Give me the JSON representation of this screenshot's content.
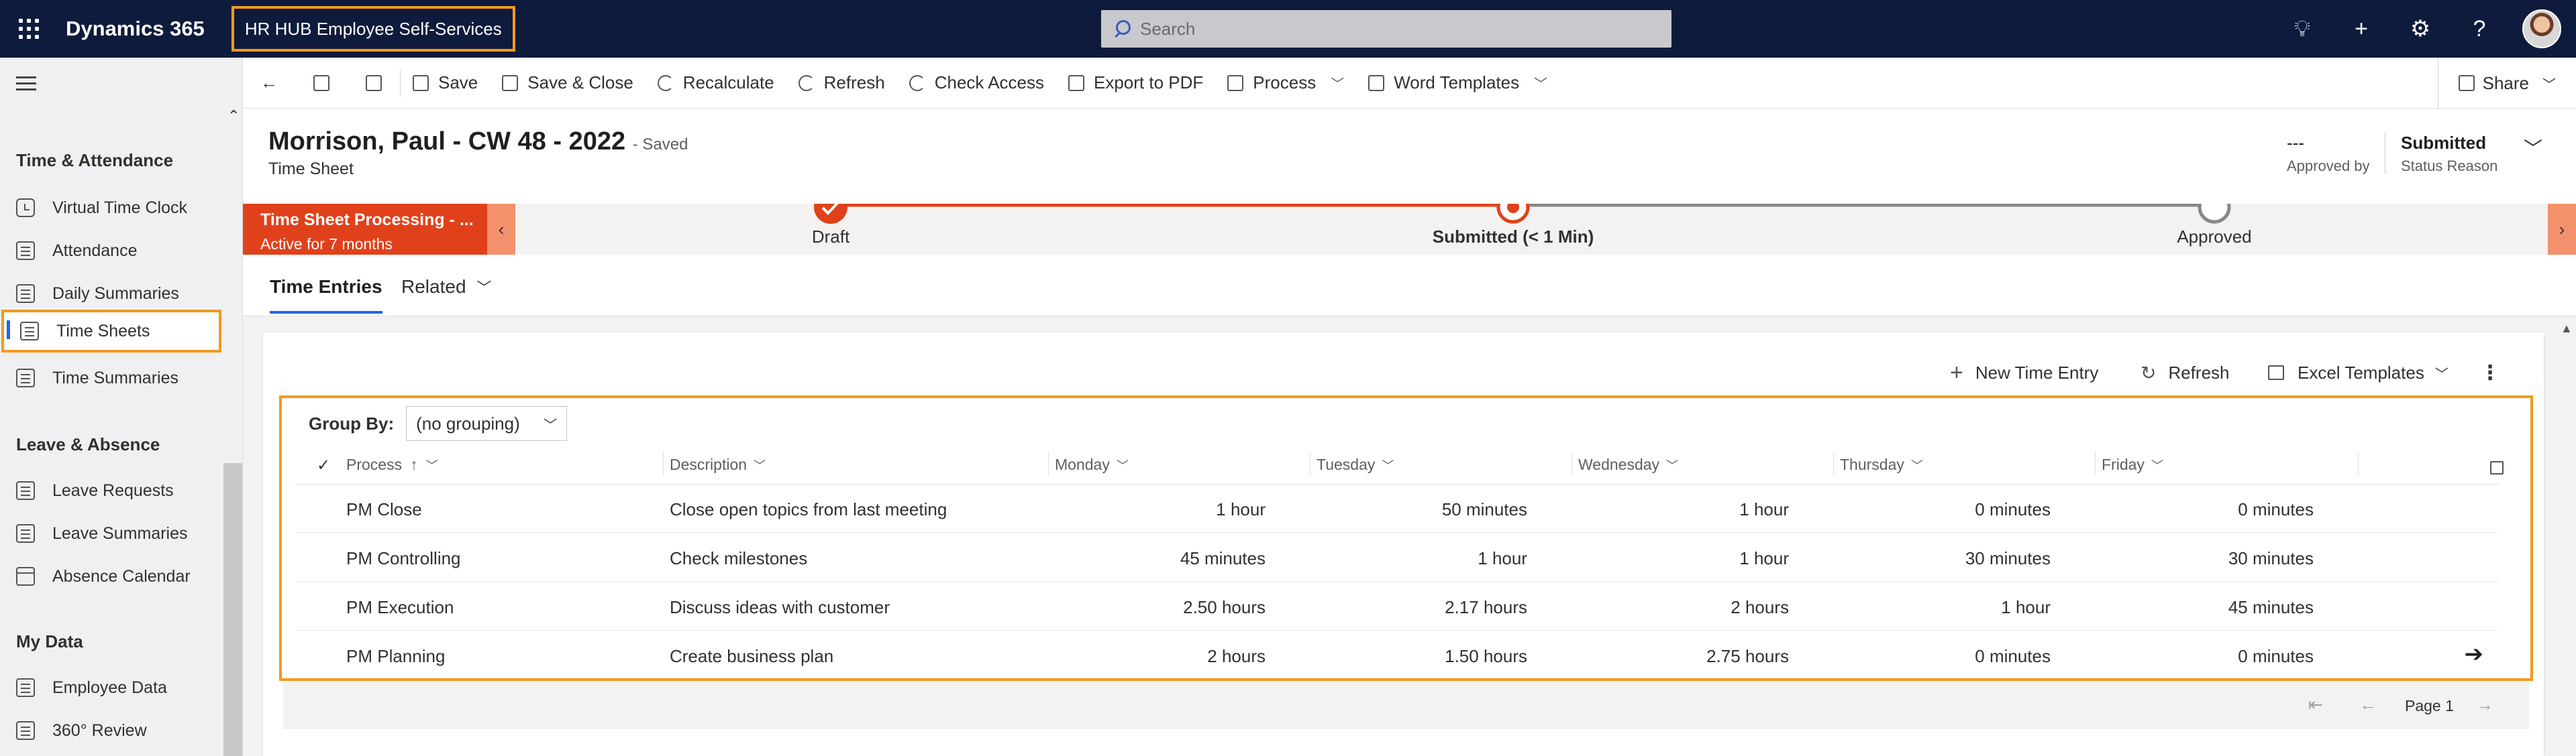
{
  "topbar": {
    "app_name": "Dynamics 365",
    "app_title": "HR HUB Employee Self-Services",
    "search_placeholder": "Search"
  },
  "sidebar": {
    "sections": [
      {
        "title": "Time & Attendance",
        "items": [
          {
            "label": "Virtual Time Clock",
            "icon": "clock-icon"
          },
          {
            "label": "Attendance",
            "icon": "attendance-icon"
          },
          {
            "label": "Daily Summaries",
            "icon": "summary-icon"
          },
          {
            "label": "Time Sheets",
            "icon": "timesheet-icon",
            "active": true
          },
          {
            "label": "Time Summaries",
            "icon": "summary-icon"
          }
        ]
      },
      {
        "title": "Leave & Absence",
        "items": [
          {
            "label": "Leave Requests",
            "icon": "leave-icon"
          },
          {
            "label": "Leave Summaries",
            "icon": "summary-icon"
          },
          {
            "label": "Absence Calendar",
            "icon": "calendar-icon"
          }
        ]
      },
      {
        "title": "My Data",
        "items": [
          {
            "label": "Employee Data",
            "icon": "id-card-icon"
          },
          {
            "label": "360° Review",
            "icon": "review-icon"
          }
        ]
      }
    ]
  },
  "commandbar": {
    "save": "Save",
    "save_close": "Save & Close",
    "recalculate": "Recalculate",
    "refresh": "Refresh",
    "check_access": "Check Access",
    "export_pdf": "Export to PDF",
    "process": "Process",
    "word_templates": "Word Templates",
    "share": "Share"
  },
  "header": {
    "title": "Morrison, Paul  - CW 48 - 2022",
    "saved_status": "- Saved",
    "entity": "Time Sheet",
    "approved_by_value": "---",
    "approved_by_label": "Approved by",
    "status_value": "Submitted",
    "status_label": "Status Reason"
  },
  "bpf": {
    "active_title": "Time Sheet Processing - ...",
    "active_subtitle": "Active for 7 months",
    "stages": [
      "Draft",
      "Submitted  (< 1 Min)",
      "Approved"
    ],
    "colors": {
      "done": "#e0411b",
      "pending": "#8a8886"
    }
  },
  "tabs": {
    "time_entries": "Time Entries",
    "related": "Related"
  },
  "subgrid": {
    "new_entry": "New Time Entry",
    "refresh": "Refresh",
    "excel_templates": "Excel Templates",
    "group_by_label": "Group By:",
    "group_by_value": "(no grouping)",
    "columns": [
      "Process",
      "Description",
      "Monday",
      "Tuesday",
      "Wednesday",
      "Thursday",
      "Friday"
    ],
    "rows": [
      {
        "process": "PM Close",
        "description": "Close open topics from last meeting",
        "monday": "1 hour",
        "tuesday": "50 minutes",
        "wednesday": "1 hour",
        "thursday": "0 minutes",
        "friday": "0 minutes"
      },
      {
        "process": "PM Controlling",
        "description": "Check milestones",
        "monday": "45 minutes",
        "tuesday": "1 hour",
        "wednesday": "1 hour",
        "thursday": "30 minutes",
        "friday": "30 minutes"
      },
      {
        "process": "PM Execution",
        "description": "Discuss ideas with customer",
        "monday": "2.50 hours",
        "tuesday": "2.17 hours",
        "wednesday": "2 hours",
        "thursday": "1 hour",
        "friday": "45 minutes"
      },
      {
        "process": "PM Planning",
        "description": "Create business plan",
        "monday": "2 hours",
        "tuesday": "1.50 hours",
        "wednesday": "2.75 hours",
        "thursday": "0 minutes",
        "friday": "0 minutes"
      }
    ],
    "page_label": "Page 1"
  }
}
